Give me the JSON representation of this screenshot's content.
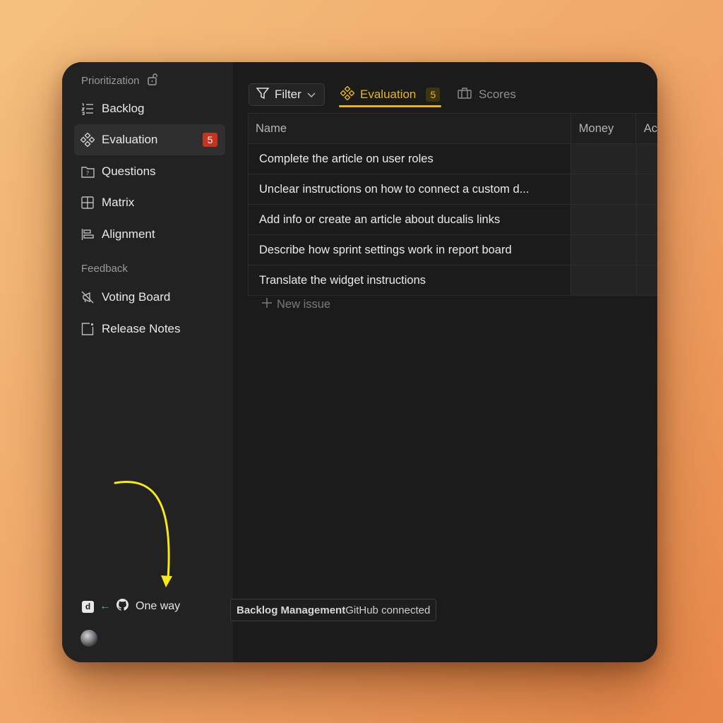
{
  "sidebar": {
    "prioritization_heading": "Prioritization",
    "items": [
      {
        "label": "Backlog",
        "icon": "list-icon"
      },
      {
        "label": "Evaluation",
        "icon": "diamond-grid-icon",
        "badge": "5"
      },
      {
        "label": "Questions",
        "icon": "question-folder-icon"
      },
      {
        "label": "Matrix",
        "icon": "grid-icon"
      },
      {
        "label": "Alignment",
        "icon": "alignment-icon"
      }
    ],
    "feedback_heading": "Feedback",
    "feedback_items": [
      {
        "label": "Voting Board",
        "icon": "megaphone-off-icon"
      },
      {
        "label": "Release Notes",
        "icon": "note-icon"
      }
    ],
    "sync": {
      "label": "One way",
      "logo_letter": "d",
      "direction_arrow": "←"
    }
  },
  "toolbar": {
    "filter_label": "Filter",
    "tabs": [
      {
        "label": "Evaluation",
        "count": "5",
        "active": true
      },
      {
        "label": "Scores",
        "active": false
      }
    ]
  },
  "table": {
    "columns": [
      "Name",
      "Money",
      "Ac"
    ],
    "rows": [
      "Complete the article on user roles",
      "Unclear instructions on how to connect a custom d...",
      "Add info or create an article about ducalis links",
      "Describe how sprint settings work in report board",
      "Translate the widget instructions"
    ],
    "new_issue_label": "New issue"
  },
  "tooltip": {
    "bold": "Backlog Management",
    "text": "GitHub connected"
  },
  "colors": {
    "accent": "#e5b420",
    "badge_red": "#c5341d",
    "sync_arrow": "#3fbf7f",
    "annotation_arrow": "#f5ea16"
  }
}
